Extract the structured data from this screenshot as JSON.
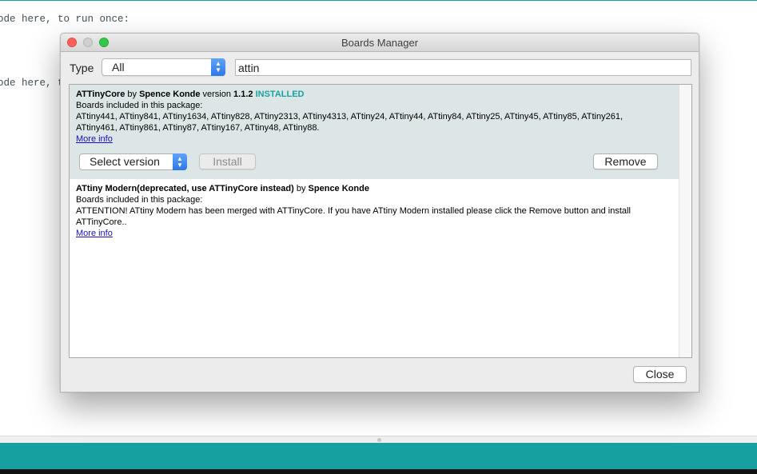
{
  "editor": {
    "line1": "ode here, to run once:",
    "line2": "ode here, to"
  },
  "dialog": {
    "title": "Boards Manager",
    "filter": {
      "type_label": "Type",
      "type_value": "All",
      "search_value": "attin"
    },
    "items": [
      {
        "name": "ATTinyCore",
        "by": " by ",
        "author": "Spence Konde",
        "version_label": " version ",
        "version": "1.1.2",
        "status": "INSTALLED",
        "boards_heading": "Boards included in this package:",
        "boards_line1": "ATtiny441, ATtiny841, ATtiny1634, ATtiny828, ATtiny2313, ATtiny4313, ATtiny24, ATtiny44, ATtiny84, ATtiny25, ATtiny45, ATtiny85, ATtiny261,",
        "boards_line2": "ATtiny461, ATtiny861, ATtiny87, ATtiny167, ATtiny48, ATtiny88.",
        "more_info": "More info",
        "select_version": "Select version",
        "install": "Install",
        "remove": "Remove"
      },
      {
        "name": "ATtiny Modern(deprecated, use ATTinyCore instead)",
        "by": " by ",
        "author": "Spence Konde",
        "boards_heading": "Boards included in this package:",
        "boards_line1": "ATTENTION! ATtiny Modern has been merged with ATTinyCore. If you have ATtiny Modern installed please click the Remove button and install",
        "boards_line2": "ATTinyCore..",
        "more_info": "More info"
      }
    ],
    "close": "Close"
  },
  "colors": {
    "accent_teal": "#16a0a0",
    "installed": "#17a2a2",
    "selected_row": "#dde6e6",
    "select_arrow": "#2f77e8"
  },
  "icons": [
    "close-window-icon",
    "minimize-window-icon",
    "zoom-window-icon",
    "chevron-updown-icon"
  ]
}
